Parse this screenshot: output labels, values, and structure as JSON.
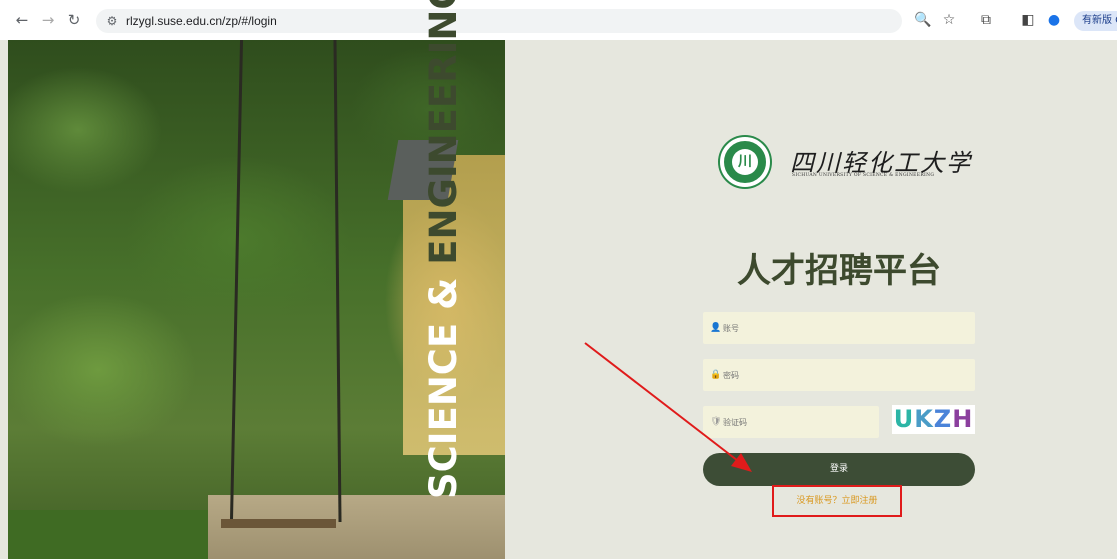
{
  "browser": {
    "url": "rlzygl.suse.edu.cn/zp/#/login",
    "update_label": "有新版 Chrome"
  },
  "hero": {
    "vertical_text_white": "SCIENCE & ",
    "vertical_text_olive": "ENGINEERING"
  },
  "logo": {
    "name_cn": "四川轻化工大学",
    "name_en": "SICHUAN UNIVERSITY OF SCIENCE & ENGINEERING"
  },
  "form": {
    "title": "人才招聘平台",
    "account_placeholder": "账号",
    "password_placeholder": "密码",
    "captcha_placeholder": "验证码",
    "captcha": [
      "U",
      "K",
      "Z",
      "H"
    ],
    "login_label": "登录",
    "register_label": "没有账号？立即注册"
  },
  "colors": {
    "panel_bg": "#e6e7de",
    "primary": "#3d4d36",
    "title": "#3d4a2e",
    "register_link": "#d9981f",
    "annotation_red": "#e01b1b"
  }
}
